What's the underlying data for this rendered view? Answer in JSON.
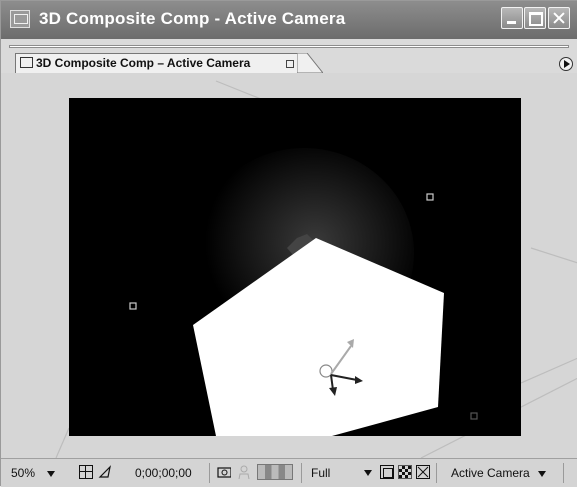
{
  "window": {
    "title": "3D Composite Comp - Active Camera"
  },
  "tab": {
    "label": "3D Composite Comp – Active Camera"
  },
  "statusbar": {
    "zoom": "50%",
    "timecode": "0;00;00;00",
    "resolution": "Full",
    "view": "Active Camera"
  },
  "icons": {
    "app": "composition-icon",
    "minimize": "minimize-icon",
    "maximize": "maximize-icon",
    "close": "close-icon",
    "panel_menu": "panel-menu-arrow-icon",
    "safe_zones": "title-action-safe-icon",
    "mask": "mask-shape-icon",
    "snapshot": "camera-snapshot-icon",
    "show_snapshot": "person-icon",
    "channels": "color-channel-icon",
    "region": "region-of-interest-icon",
    "transparency": "checkerboard-icon",
    "pixel_aspect": "pixel-aspect-icon"
  },
  "colors": {
    "titlebar": "#7a7a7a",
    "viewer": "#000000",
    "layer": "#ffffff"
  }
}
